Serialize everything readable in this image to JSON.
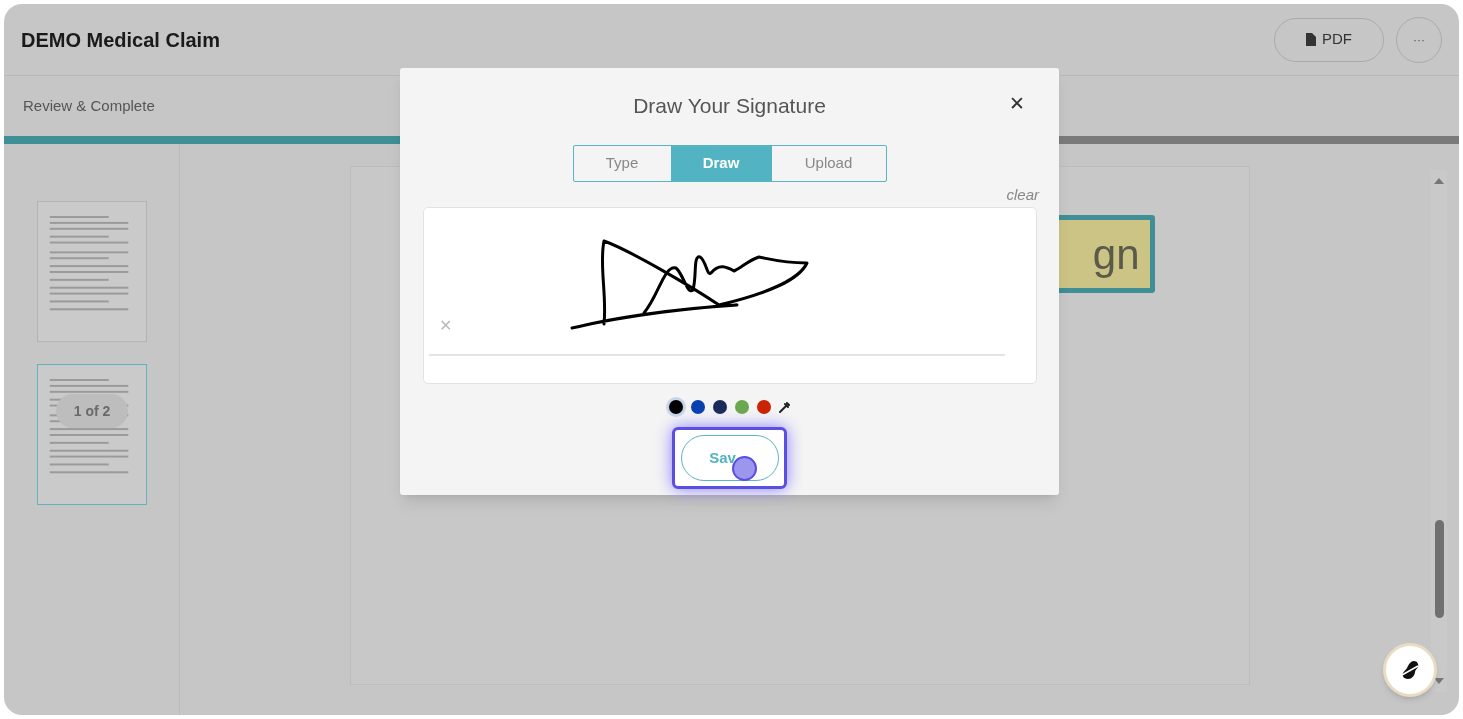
{
  "header": {
    "title": "DEMO Medical Claim",
    "pdf_button": "PDF",
    "more_button": "···"
  },
  "step": {
    "label": "Review & Complete",
    "level": 0.45
  },
  "thumbnails": [
    {
      "selected": false
    },
    {
      "selected": true
    }
  ],
  "page_badge": "1 of 2",
  "sign_tag": "gn",
  "dialog": {
    "title": "Draw Your Signature",
    "close": "✕",
    "tabs": [
      {
        "label": "Type",
        "selected": false
      },
      {
        "label": "Draw",
        "selected": true
      },
      {
        "label": "Upload",
        "selected": false
      }
    ],
    "clear": "clear",
    "line_mark": "✕",
    "colors": [
      {
        "color": "#000000",
        "selected": true
      },
      {
        "color": "#0a3fb0",
        "selected": false
      },
      {
        "color": "#1a2a5a",
        "selected": false
      },
      {
        "color": "#6aa84f",
        "selected": false
      },
      {
        "color": "#cc2200",
        "selected": false
      }
    ],
    "save": "Sav"
  }
}
